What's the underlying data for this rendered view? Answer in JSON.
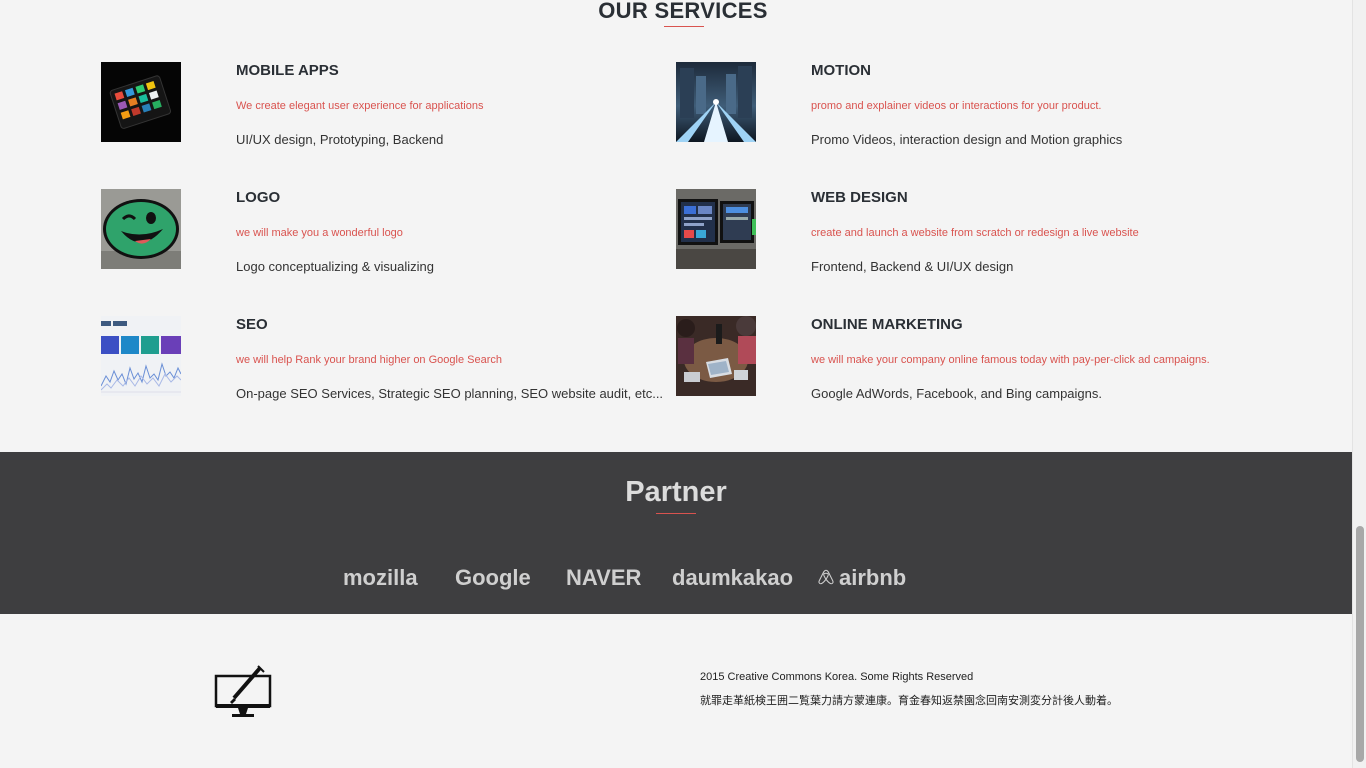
{
  "services": {
    "title": "OUR SERVICES",
    "items": [
      {
        "name": "MOBILE APPS",
        "tagline": "We create elegant user experience for applications",
        "detail": "UI/UX design, Prototyping, Backend"
      },
      {
        "name": "MOTION",
        "tagline": "promo and explainer videos or interactions for your product.",
        "detail": "Promo Videos, interaction design and Motion graphics"
      },
      {
        "name": "LOGO",
        "tagline": "we will make you a wonderful logo",
        "detail": "Logo conceptualizing & visualizing"
      },
      {
        "name": "WEB DESIGN",
        "tagline": "create and launch a website from scratch or redesign a live website",
        "detail": "Frontend, Backend & UI/UX design"
      },
      {
        "name": "SEO",
        "tagline": "we will help Rank your brand higher on Google Search",
        "detail": "On-page SEO Services, Strategic SEO planning, SEO website audit, etc..."
      },
      {
        "name": "ONLINE MARKETING",
        "tagline": "we will make your company online famous today with pay-per-click ad campaigns.",
        "detail": "Google AdWords, Facebook, and Bing campaigns."
      }
    ]
  },
  "partner": {
    "title": "Partner",
    "logos": [
      "mozilla",
      "Google",
      "NAVER",
      "daumkakao",
      "airbnb"
    ]
  },
  "footer": {
    "copyright": "2015 Creative Commons Korea. Some Rights Reserved",
    "cjk_text": "就罪走革紙検王囲二覧葉力請方蒙連康。育金春知返禁園念回南安測変分計後人動着。",
    "logo_icon": "monitor-pen-icon"
  },
  "colors": {
    "accent": "#d9534f",
    "heading": "#2a2f35",
    "partner_bg": "#3e3e40",
    "page_bg": "#f4f4f4"
  }
}
